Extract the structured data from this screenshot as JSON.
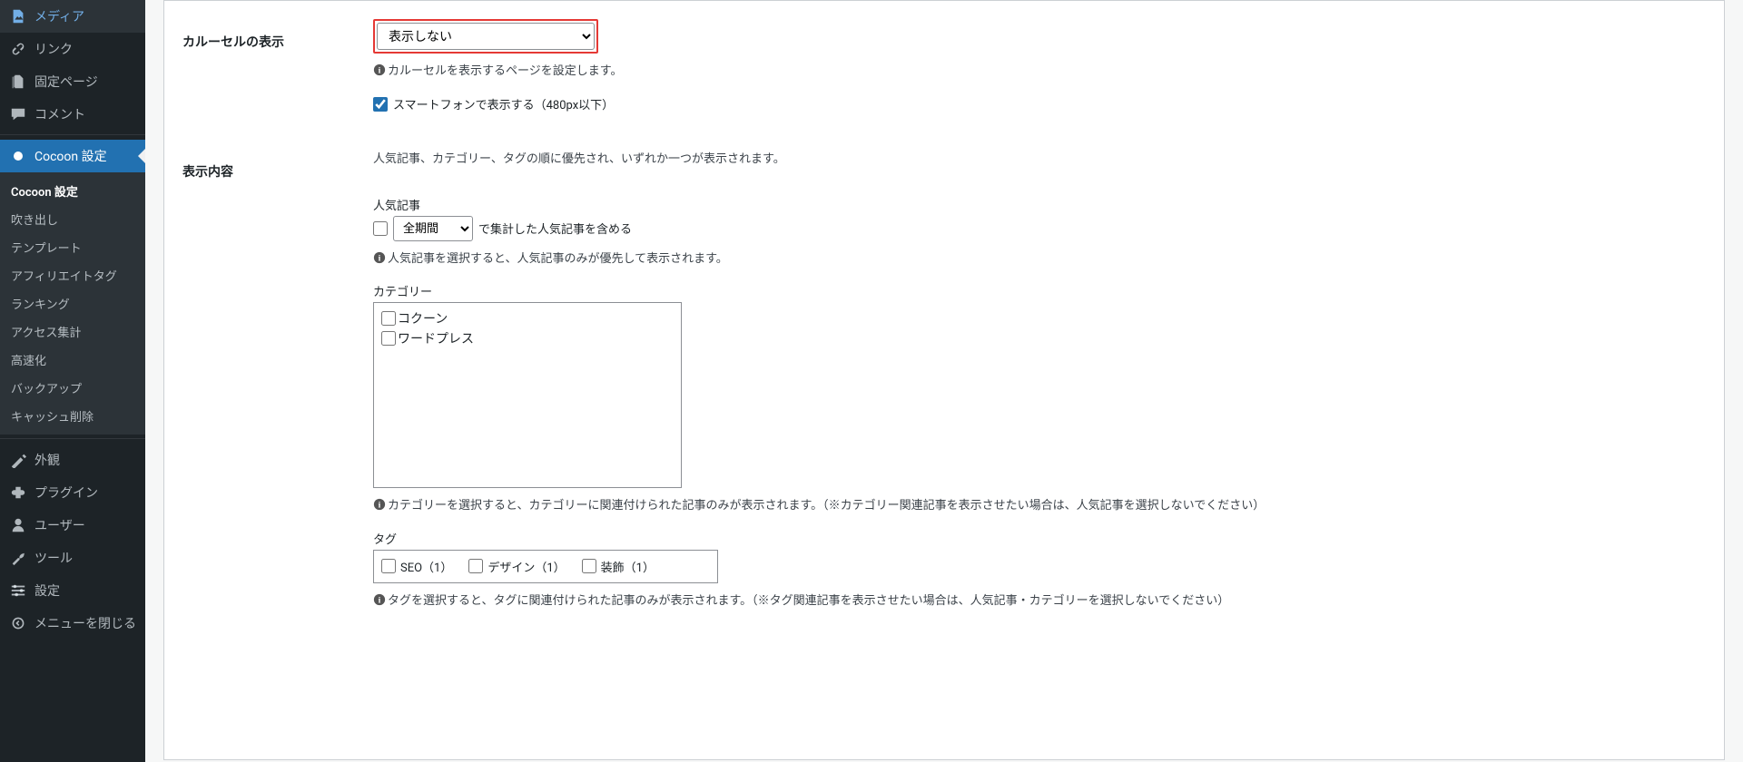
{
  "sidebar": {
    "top_items": [
      {
        "icon": "media-icon",
        "label": "メディア"
      },
      {
        "icon": "link-icon",
        "label": "リンク"
      },
      {
        "icon": "page-icon",
        "label": "固定ページ"
      },
      {
        "icon": "comment-icon",
        "label": "コメント"
      }
    ],
    "current": {
      "icon": "cocoon-icon",
      "label": "Cocoon 設定"
    },
    "submenu": [
      "Cocoon 設定",
      "吹き出し",
      "テンプレート",
      "アフィリエイトタグ",
      "ランキング",
      "アクセス集計",
      "高速化",
      "バックアップ",
      "キャッシュ削除"
    ],
    "submenu_active": "Cocoon 設定",
    "bottom_items": [
      {
        "icon": "appearance-icon",
        "label": "外観"
      },
      {
        "icon": "plugin-icon",
        "label": "プラグイン"
      },
      {
        "icon": "users-icon",
        "label": "ユーザー"
      },
      {
        "icon": "tools-icon",
        "label": "ツール"
      },
      {
        "icon": "settings-icon",
        "label": "設定"
      }
    ],
    "collapse": {
      "icon": "collapse-icon",
      "label": "メニューを閉じる"
    }
  },
  "form": {
    "carousel": {
      "label": "カルーセルの表示",
      "select_value": "表示しない",
      "hint": "カルーセルを表示するページを設定します。",
      "sp_checkbox_label": "スマートフォンで表示する（480px以下）",
      "sp_checked": true
    },
    "content": {
      "label": "表示内容",
      "intro": "人気記事、カテゴリー、タグの順に優先され、いずれか一つが表示されます。",
      "popular": {
        "legend": "人気記事",
        "period_checked": false,
        "period_select": "全期間",
        "period_suffix": "で集計した人気記事を含める",
        "hint": "人気記事を選択すると、人気記事のみが優先して表示されます。"
      },
      "category": {
        "legend": "カテゴリー",
        "items": [
          {
            "label": "コクーン",
            "checked": false
          },
          {
            "label": "ワードプレス",
            "checked": false
          }
        ],
        "hint": "カテゴリーを選択すると、カテゴリーに関連付けられた記事のみが表示されます。（※カテゴリー関連記事を表示させたい場合は、人気記事を選択しないでください）"
      },
      "tag": {
        "legend": "タグ",
        "items": [
          {
            "label": "SEO（1）",
            "checked": false
          },
          {
            "label": "デザイン（1）",
            "checked": false
          },
          {
            "label": "装飾（1）",
            "checked": false
          }
        ],
        "hint": "タグを選択すると、タグに関連付けられた記事のみが表示されます。（※タグ関連記事を表示させたい場合は、人気記事・カテゴリーを選択しないでください）"
      }
    }
  }
}
